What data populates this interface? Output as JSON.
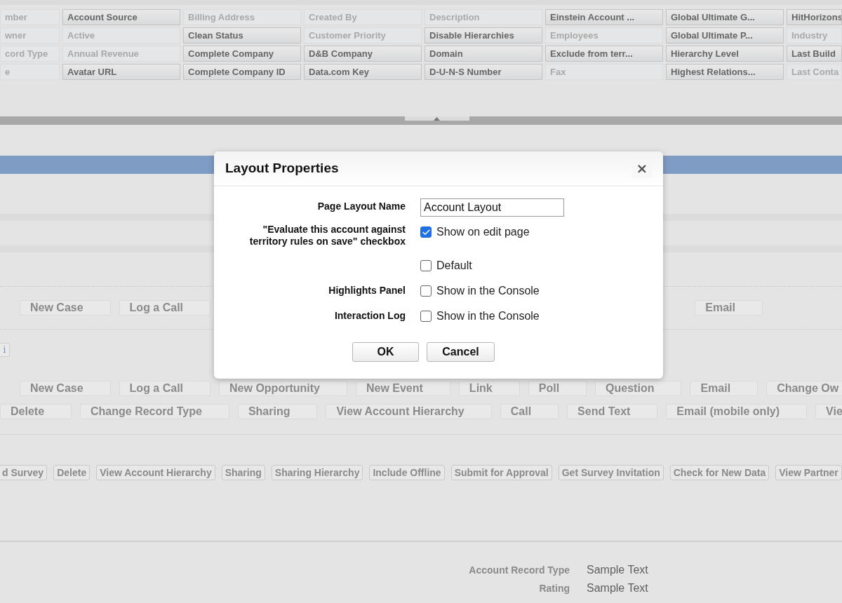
{
  "palette_fields": [
    [
      {
        "label": "mber",
        "in_layout": true
      },
      {
        "label": "Account Source",
        "in_layout": false
      },
      {
        "label": "Billing Address",
        "in_layout": true
      },
      {
        "label": "Created By",
        "in_layout": true
      },
      {
        "label": "Description",
        "in_layout": true
      },
      {
        "label": "Einstein Account ...",
        "in_layout": false
      },
      {
        "label": "Global Ultimate G...",
        "in_layout": false
      },
      {
        "label": "HitHorizons",
        "in_layout": false
      }
    ],
    [
      {
        "label": "wner",
        "in_layout": true
      },
      {
        "label": "Active",
        "in_layout": true
      },
      {
        "label": "Clean Status",
        "in_layout": false
      },
      {
        "label": "Customer Priority",
        "in_layout": true
      },
      {
        "label": "Disable Hierarchies",
        "in_layout": false
      },
      {
        "label": "Employees",
        "in_layout": true
      },
      {
        "label": "Global Ultimate P...",
        "in_layout": false
      },
      {
        "label": "Industry",
        "in_layout": true
      }
    ],
    [
      {
        "label": "cord Type",
        "in_layout": true
      },
      {
        "label": "Annual Revenue",
        "in_layout": true
      },
      {
        "label": "Complete Company",
        "in_layout": false
      },
      {
        "label": "D&B Company",
        "in_layout": false
      },
      {
        "label": "Domain",
        "in_layout": false
      },
      {
        "label": "Exclude from terr...",
        "in_layout": false
      },
      {
        "label": "Hierarchy Level",
        "in_layout": false
      },
      {
        "label": "Last Build",
        "in_layout": false
      }
    ],
    [
      {
        "label": "e",
        "in_layout": true
      },
      {
        "label": "Avatar URL",
        "in_layout": false
      },
      {
        "label": "Complete Company ID",
        "in_layout": false
      },
      {
        "label": "Data.com Key",
        "in_layout": false
      },
      {
        "label": "D-U-N-S Number",
        "in_layout": false
      },
      {
        "label": "Fax",
        "in_layout": true
      },
      {
        "label": "Highest Relations...",
        "in_layout": false
      },
      {
        "label": "Last Conta",
        "in_layout": true
      }
    ]
  ],
  "classic_actions": {
    "left": [
      "New Case",
      "Log a Call"
    ],
    "right": [
      "Email"
    ]
  },
  "info_button": "i",
  "quick_actions": [
    [
      "New Case",
      "Log a Call",
      "New Opportunity",
      "New Event",
      "Link",
      "Poll",
      "Question",
      "Email",
      "Change Ow"
    ],
    [
      "Delete",
      "Change Record Type",
      "Sharing",
      "View Account Hierarchy",
      "Call",
      "Send Text",
      "Email (mobile only)",
      "Vie"
    ]
  ],
  "custom_buttons": [
    "d Survey",
    "Delete",
    "View Account Hierarchy",
    "Sharing",
    "Sharing Hierarchy",
    "Include Offline",
    "Submit for Approval",
    "Get Survey Invitation",
    "Check for New Data",
    "View Partner"
  ],
  "detail_fields": [
    {
      "label": "Account Record Type",
      "value": "Sample Text"
    },
    {
      "label": "Rating",
      "value": "Sample Text"
    }
  ],
  "dialog": {
    "title": "Layout Properties",
    "close": "×",
    "rows": [
      {
        "kind": "text",
        "label": "Page Layout Name",
        "value": "Account Layout"
      },
      {
        "kind": "checkbox",
        "label": "\"Evaluate this account against territory rules on save\" checkbox",
        "option": "Show on edit page",
        "checked": true
      },
      {
        "kind": "checkbox",
        "option": "Default",
        "checked": false
      },
      {
        "kind": "checkbox",
        "label": "Highlights Panel",
        "option": "Show in the Console",
        "checked": false
      },
      {
        "kind": "checkbox",
        "label": "Interaction Log",
        "option": "Show in the Console",
        "checked": false
      }
    ],
    "buttons": [
      "OK",
      "Cancel"
    ]
  }
}
